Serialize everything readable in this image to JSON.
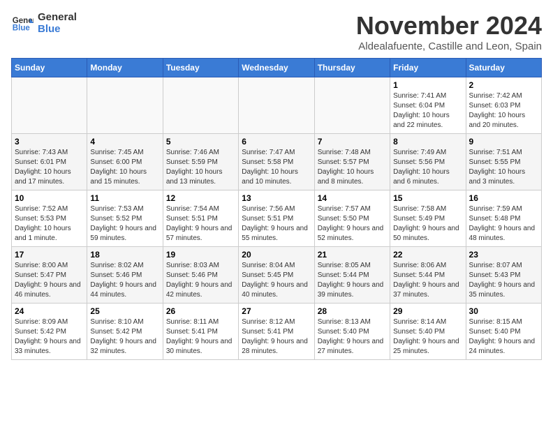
{
  "header": {
    "logo_line1": "General",
    "logo_line2": "Blue",
    "month_title": "November 2024",
    "location": "Aldealafuente, Castille and Leon, Spain"
  },
  "days_of_week": [
    "Sunday",
    "Monday",
    "Tuesday",
    "Wednesday",
    "Thursday",
    "Friday",
    "Saturday"
  ],
  "weeks": [
    [
      {
        "day": "",
        "info": ""
      },
      {
        "day": "",
        "info": ""
      },
      {
        "day": "",
        "info": ""
      },
      {
        "day": "",
        "info": ""
      },
      {
        "day": "",
        "info": ""
      },
      {
        "day": "1",
        "info": "Sunrise: 7:41 AM\nSunset: 6:04 PM\nDaylight: 10 hours and 22 minutes."
      },
      {
        "day": "2",
        "info": "Sunrise: 7:42 AM\nSunset: 6:03 PM\nDaylight: 10 hours and 20 minutes."
      }
    ],
    [
      {
        "day": "3",
        "info": "Sunrise: 7:43 AM\nSunset: 6:01 PM\nDaylight: 10 hours and 17 minutes."
      },
      {
        "day": "4",
        "info": "Sunrise: 7:45 AM\nSunset: 6:00 PM\nDaylight: 10 hours and 15 minutes."
      },
      {
        "day": "5",
        "info": "Sunrise: 7:46 AM\nSunset: 5:59 PM\nDaylight: 10 hours and 13 minutes."
      },
      {
        "day": "6",
        "info": "Sunrise: 7:47 AM\nSunset: 5:58 PM\nDaylight: 10 hours and 10 minutes."
      },
      {
        "day": "7",
        "info": "Sunrise: 7:48 AM\nSunset: 5:57 PM\nDaylight: 10 hours and 8 minutes."
      },
      {
        "day": "8",
        "info": "Sunrise: 7:49 AM\nSunset: 5:56 PM\nDaylight: 10 hours and 6 minutes."
      },
      {
        "day": "9",
        "info": "Sunrise: 7:51 AM\nSunset: 5:55 PM\nDaylight: 10 hours and 3 minutes."
      }
    ],
    [
      {
        "day": "10",
        "info": "Sunrise: 7:52 AM\nSunset: 5:53 PM\nDaylight: 10 hours and 1 minute."
      },
      {
        "day": "11",
        "info": "Sunrise: 7:53 AM\nSunset: 5:52 PM\nDaylight: 9 hours and 59 minutes."
      },
      {
        "day": "12",
        "info": "Sunrise: 7:54 AM\nSunset: 5:51 PM\nDaylight: 9 hours and 57 minutes."
      },
      {
        "day": "13",
        "info": "Sunrise: 7:56 AM\nSunset: 5:51 PM\nDaylight: 9 hours and 55 minutes."
      },
      {
        "day": "14",
        "info": "Sunrise: 7:57 AM\nSunset: 5:50 PM\nDaylight: 9 hours and 52 minutes."
      },
      {
        "day": "15",
        "info": "Sunrise: 7:58 AM\nSunset: 5:49 PM\nDaylight: 9 hours and 50 minutes."
      },
      {
        "day": "16",
        "info": "Sunrise: 7:59 AM\nSunset: 5:48 PM\nDaylight: 9 hours and 48 minutes."
      }
    ],
    [
      {
        "day": "17",
        "info": "Sunrise: 8:00 AM\nSunset: 5:47 PM\nDaylight: 9 hours and 46 minutes."
      },
      {
        "day": "18",
        "info": "Sunrise: 8:02 AM\nSunset: 5:46 PM\nDaylight: 9 hours and 44 minutes."
      },
      {
        "day": "19",
        "info": "Sunrise: 8:03 AM\nSunset: 5:46 PM\nDaylight: 9 hours and 42 minutes."
      },
      {
        "day": "20",
        "info": "Sunrise: 8:04 AM\nSunset: 5:45 PM\nDaylight: 9 hours and 40 minutes."
      },
      {
        "day": "21",
        "info": "Sunrise: 8:05 AM\nSunset: 5:44 PM\nDaylight: 9 hours and 39 minutes."
      },
      {
        "day": "22",
        "info": "Sunrise: 8:06 AM\nSunset: 5:44 PM\nDaylight: 9 hours and 37 minutes."
      },
      {
        "day": "23",
        "info": "Sunrise: 8:07 AM\nSunset: 5:43 PM\nDaylight: 9 hours and 35 minutes."
      }
    ],
    [
      {
        "day": "24",
        "info": "Sunrise: 8:09 AM\nSunset: 5:42 PM\nDaylight: 9 hours and 33 minutes."
      },
      {
        "day": "25",
        "info": "Sunrise: 8:10 AM\nSunset: 5:42 PM\nDaylight: 9 hours and 32 minutes."
      },
      {
        "day": "26",
        "info": "Sunrise: 8:11 AM\nSunset: 5:41 PM\nDaylight: 9 hours and 30 minutes."
      },
      {
        "day": "27",
        "info": "Sunrise: 8:12 AM\nSunset: 5:41 PM\nDaylight: 9 hours and 28 minutes."
      },
      {
        "day": "28",
        "info": "Sunrise: 8:13 AM\nSunset: 5:40 PM\nDaylight: 9 hours and 27 minutes."
      },
      {
        "day": "29",
        "info": "Sunrise: 8:14 AM\nSunset: 5:40 PM\nDaylight: 9 hours and 25 minutes."
      },
      {
        "day": "30",
        "info": "Sunrise: 8:15 AM\nSunset: 5:40 PM\nDaylight: 9 hours and 24 minutes."
      }
    ]
  ]
}
